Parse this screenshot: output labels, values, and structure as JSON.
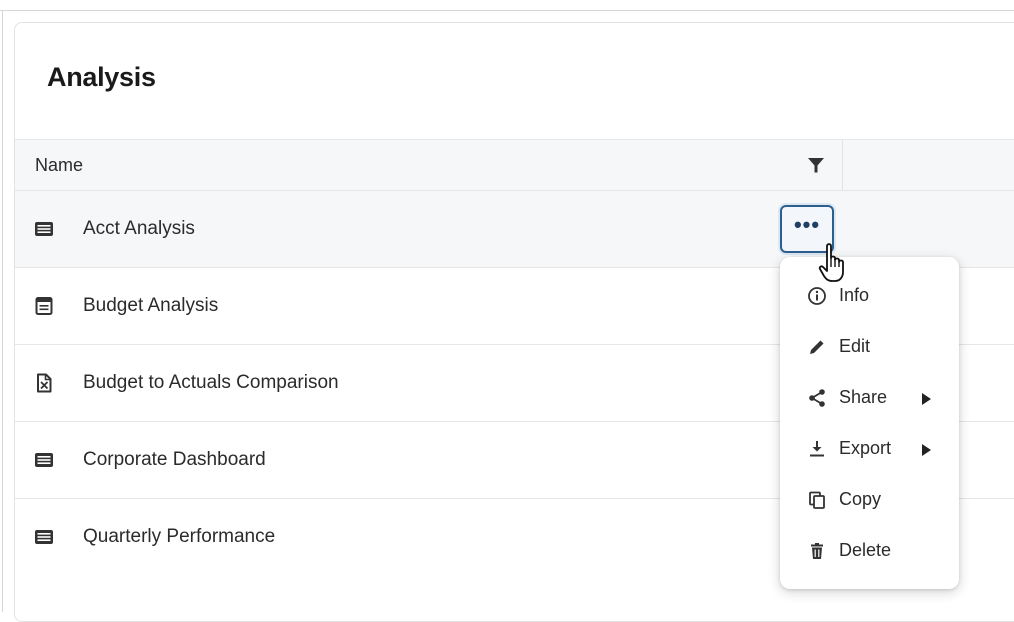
{
  "page": {
    "title": "Analysis"
  },
  "table": {
    "column_name": "Name",
    "rows": [
      {
        "label": "Acct Analysis",
        "icon": "table-icon"
      },
      {
        "label": "Budget Analysis",
        "icon": "calendar-sheet-icon"
      },
      {
        "label": "Budget to Actuals Comparison",
        "icon": "report-doc-icon"
      },
      {
        "label": "Corporate Dashboard",
        "icon": "table-icon"
      },
      {
        "label": "Quarterly Performance",
        "icon": "table-icon"
      }
    ]
  },
  "more_button": {
    "label": "•••"
  },
  "context_menu": {
    "items": [
      {
        "label": "Info",
        "icon": "info-icon",
        "submenu": false
      },
      {
        "label": "Edit",
        "icon": "pencil-icon",
        "submenu": false
      },
      {
        "label": "Share",
        "icon": "share-icon",
        "submenu": true
      },
      {
        "label": "Export",
        "icon": "download-icon",
        "submenu": true
      },
      {
        "label": "Copy",
        "icon": "copy-icon",
        "submenu": false
      },
      {
        "label": "Delete",
        "icon": "trash-icon",
        "submenu": false
      }
    ]
  },
  "colors": {
    "accent": "#2d5f8e",
    "header_bg": "#f6f7f9",
    "text": "#2b2b2b"
  }
}
